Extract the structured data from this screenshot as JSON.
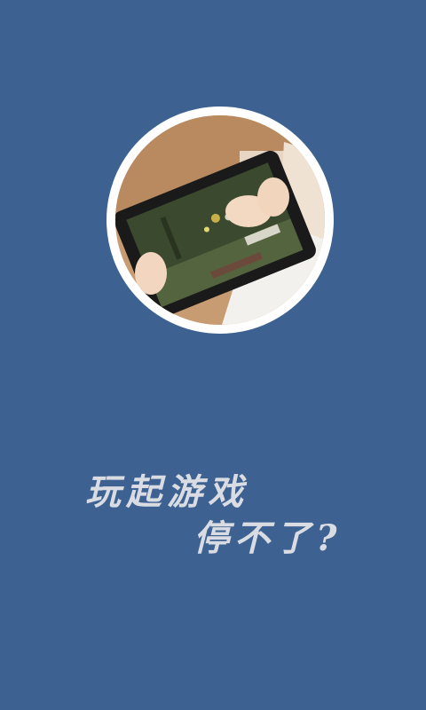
{
  "splash": {
    "background_color": "#3d6191",
    "avatar": {
      "icon": "child-playing-tablet-photo",
      "ring_color": "#ffffff"
    },
    "slogan": {
      "line1": "玩起游戏",
      "line2": "停不了?"
    }
  }
}
